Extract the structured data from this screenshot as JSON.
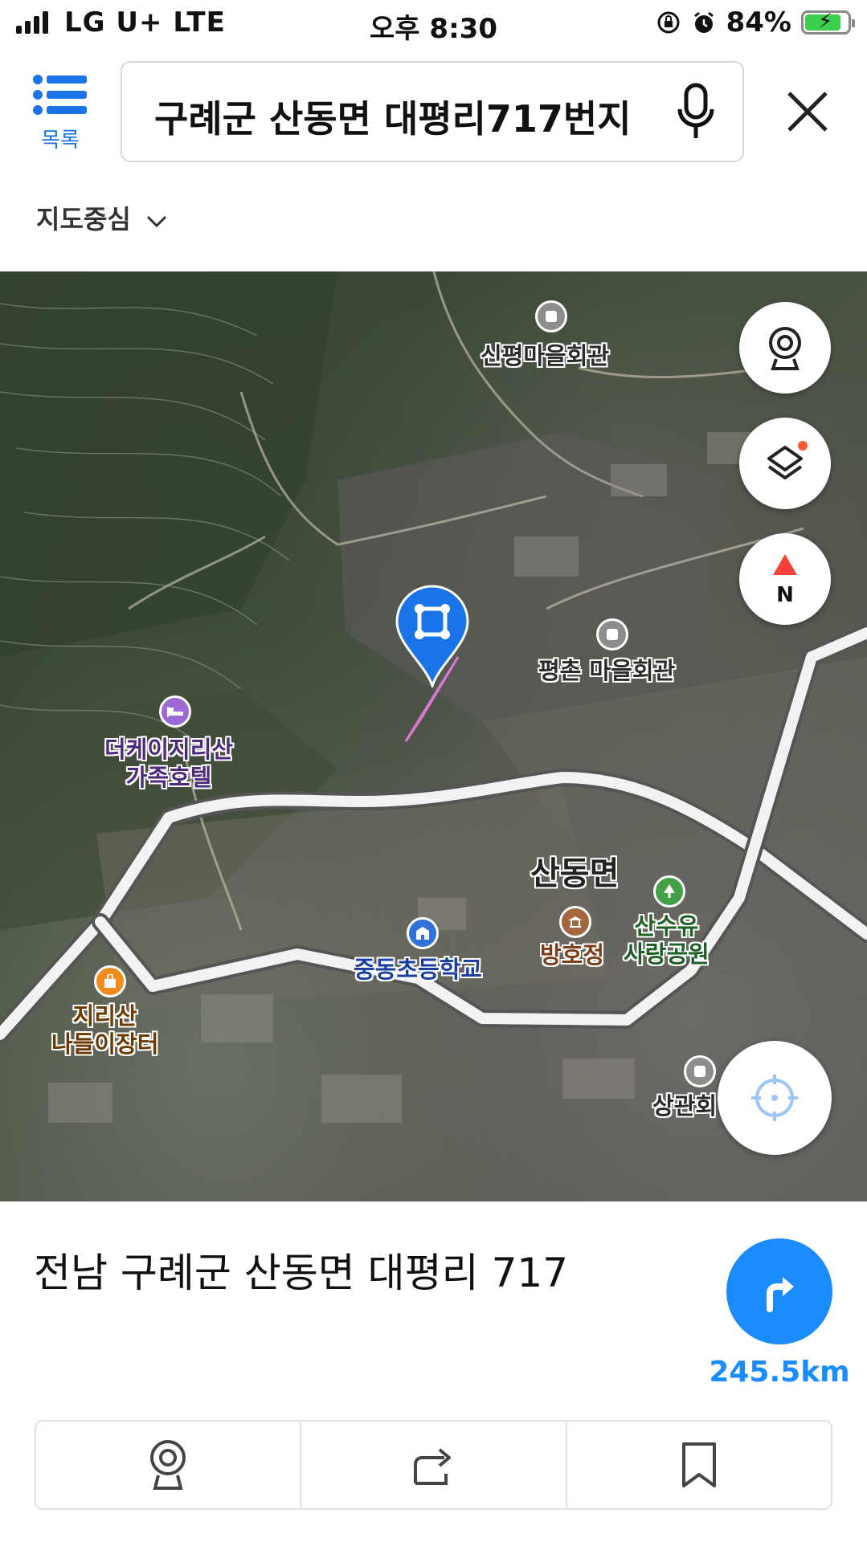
{
  "status_bar": {
    "carrier": "LG U+  LTE",
    "time": "오후 8:30",
    "battery": "84%",
    "battery_level": 0.84
  },
  "header": {
    "menu_label": "목록",
    "search_query": "구례군 산동면 대평리717번지",
    "map_center_label": "지도중심"
  },
  "map": {
    "pois": [
      {
        "id": "sinpyeong",
        "label": "신평마을회관"
      },
      {
        "id": "pyeongchon",
        "label": "평촌 마을회관"
      },
      {
        "id": "hotel",
        "label_line1": "더케이지리산",
        "label_line2": "가족호텔"
      },
      {
        "id": "area",
        "label": "산동면"
      },
      {
        "id": "park",
        "label_line1": "산수유",
        "label_line2": "사랑공원"
      },
      {
        "id": "banghojeong",
        "label": "방호정"
      },
      {
        "id": "school",
        "label": "중동초등학교"
      },
      {
        "id": "market",
        "label_line1": "지리산",
        "label_line2": "나들이장터"
      },
      {
        "id": "sanggwan",
        "label": "상관회"
      }
    ],
    "compass_label": "N"
  },
  "place": {
    "address": "전남 구례군 산동면 대평리 717",
    "distance": "245.5km"
  },
  "colors": {
    "accent": "#1a8cff",
    "pin": "#1a73e8",
    "parcel": "#d97ad0"
  }
}
